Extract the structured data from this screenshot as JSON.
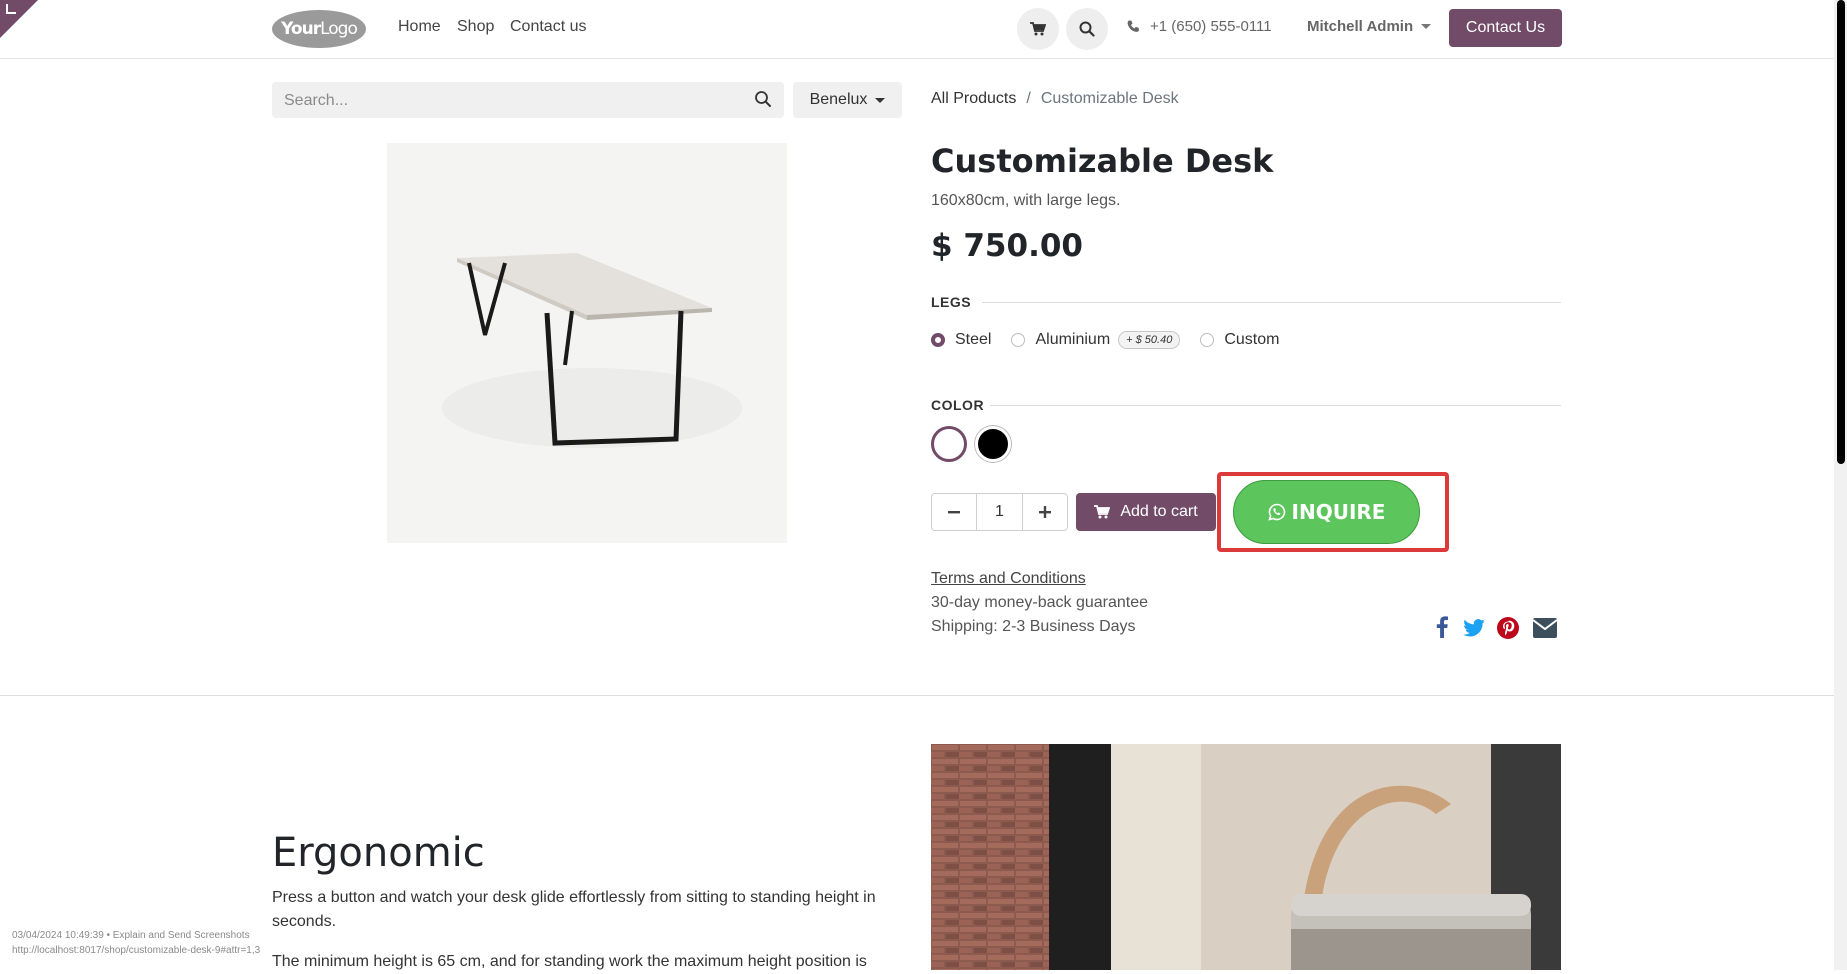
{
  "header": {
    "logo": {
      "bold": "Your",
      "thin": "Logo"
    },
    "nav": [
      "Home",
      "Shop",
      "Contact us"
    ],
    "phone": "+1 (650) 555-0111",
    "user": "Mitchell Admin",
    "contact_button": "Contact Us"
  },
  "search": {
    "placeholder": "Search...",
    "value": ""
  },
  "pricelist": "Benelux",
  "breadcrumb": {
    "parent": "All Products",
    "separator": "/",
    "current": "Customizable Desk"
  },
  "product": {
    "name": "Customizable Desk",
    "description": "160x80cm, with large legs.",
    "price": "$ 750.00",
    "legs": {
      "heading": "LEGS",
      "options": [
        {
          "label": "Steel",
          "selected": true
        },
        {
          "label": "Aluminium",
          "extra": "+ $ 50.40",
          "selected": false
        },
        {
          "label": "Custom",
          "selected": false
        }
      ]
    },
    "color": {
      "heading": "COLOR",
      "swatches": [
        {
          "name": "White",
          "hex": "#ffffff",
          "selected": true
        },
        {
          "name": "Black",
          "hex": "#000000",
          "selected": false
        }
      ]
    },
    "quantity": "1",
    "add_to_cart": "Add to cart",
    "inquire": "INQUIRE",
    "terms": "Terms and Conditions",
    "guarantee": "30-day money-back guarantee",
    "shipping": "Shipping: 2-3 Business Days"
  },
  "section": {
    "heading": "Ergonomic",
    "para1": "Press a button and watch your desk glide effortlessly from sitting to standing height in seconds.",
    "para2": "The minimum height is 65 cm, and for standing work the maximum height position is"
  },
  "overlay": {
    "timestamp": "03/04/2024 10:49:39 • Explain and Send Screenshots",
    "url": "http://localhost:8017/shop/customizable-desk-9#attr=1,3"
  },
  "colors": {
    "brand": "#714b67",
    "inquire_green": "#5cc55c",
    "highlight_red": "#dc3a3a",
    "facebook": "#3b5998",
    "twitter": "#1da1f2",
    "pinterest": "#bd081c",
    "email": "#3d4f5c"
  }
}
